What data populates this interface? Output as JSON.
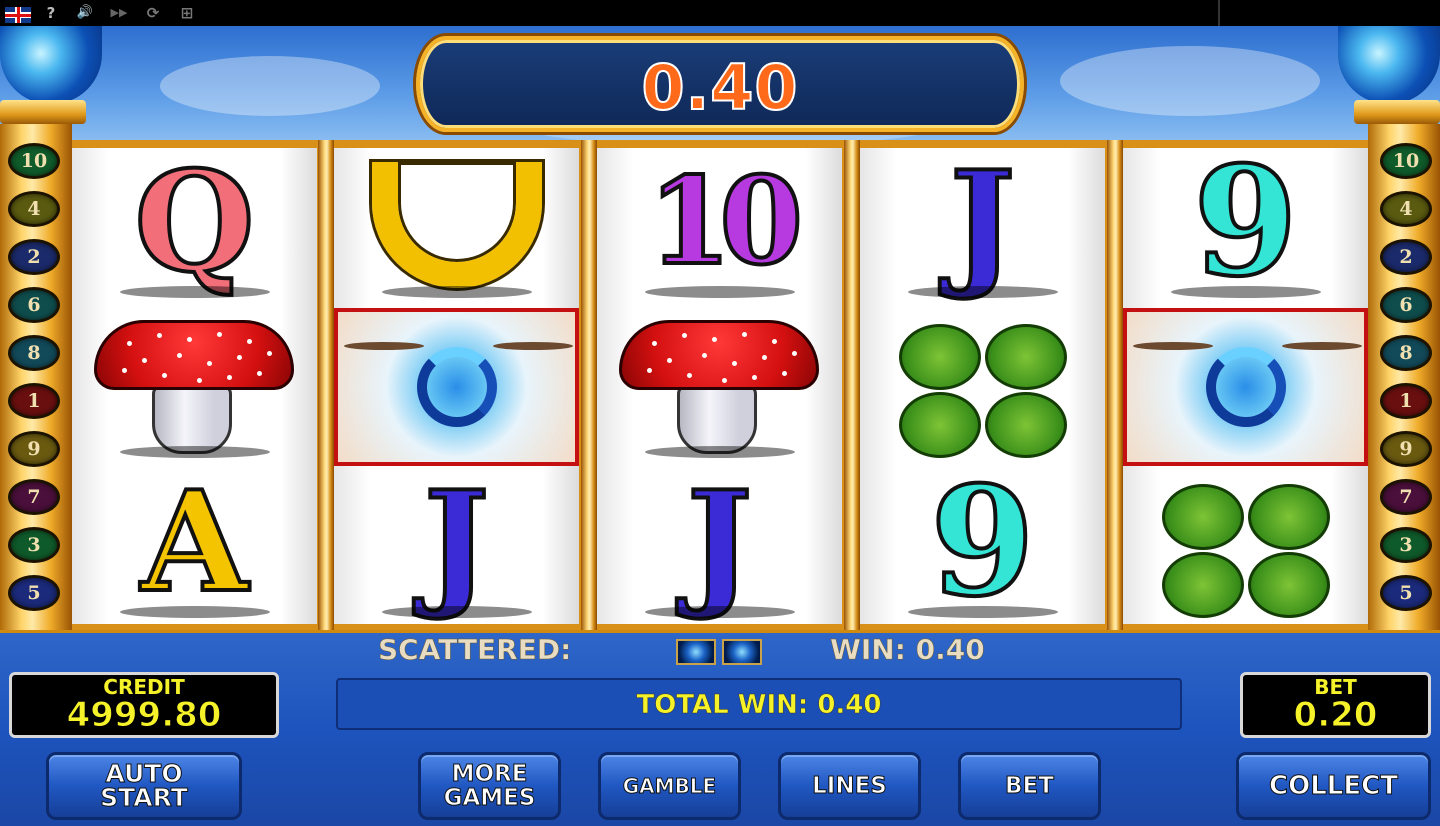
{
  "toolbar": {
    "items": [
      {
        "name": "language-flag",
        "glyph": ""
      },
      {
        "name": "help",
        "glyph": "?"
      },
      {
        "name": "sound",
        "glyph": "🔊"
      },
      {
        "name": "fast-forward",
        "glyph": "▶▶"
      },
      {
        "name": "refresh",
        "glyph": "⟳"
      },
      {
        "name": "fullscreen",
        "glyph": "⊞"
      }
    ]
  },
  "top_win": "0.40",
  "paylines_left": [
    "10",
    "4",
    "2",
    "6",
    "8",
    "1",
    "9",
    "7",
    "3",
    "5"
  ],
  "paylines_right": [
    "10",
    "4",
    "2",
    "6",
    "8",
    "1",
    "9",
    "7",
    "3",
    "5"
  ],
  "payline_colors": {
    "10": "#0f5b2a",
    "4": "#5a5a10",
    "2": "#1b2a6a",
    "6": "#0f4d4d",
    "8": "#124a5a",
    "1": "#6a0f0f",
    "9": "#6a5a10",
    "7": "#4a0f3a",
    "3": "#0f5a2a",
    "5": "#1b2a7a"
  },
  "reels": [
    {
      "symbols": [
        "Q",
        "mushroom",
        "A"
      ]
    },
    {
      "symbols": [
        "horseshoe",
        "eye",
        "J"
      ]
    },
    {
      "symbols": [
        "10",
        "mushroom",
        "J"
      ]
    },
    {
      "symbols": [
        "J",
        "clover",
        "9"
      ]
    },
    {
      "symbols": [
        "9",
        "eye",
        "clover"
      ]
    }
  ],
  "highlighted_symbol": "eye",
  "scatter": {
    "label": "SCATTERED:",
    "icons": [
      "eye-icon",
      "eye-icon"
    ]
  },
  "win": {
    "label": "WIN: 0.40"
  },
  "total_win": "TOTAL WIN: 0.40",
  "credit": {
    "label": "CREDIT",
    "value": "4999.80"
  },
  "bet": {
    "label": "BET",
    "value": "0.20"
  },
  "buttons": {
    "auto_start": "AUTO\nSTART",
    "more_games": "MORE\nGAMES",
    "gamble": "GAMBLE",
    "lines": "LINES",
    "bet": "BET",
    "collect": "COLLECT"
  },
  "colors": {
    "win_text": "#ff6a1a",
    "meter_text": "#f6f22a",
    "frame_gold": "#d89018",
    "highlight_border": "#c41010"
  }
}
